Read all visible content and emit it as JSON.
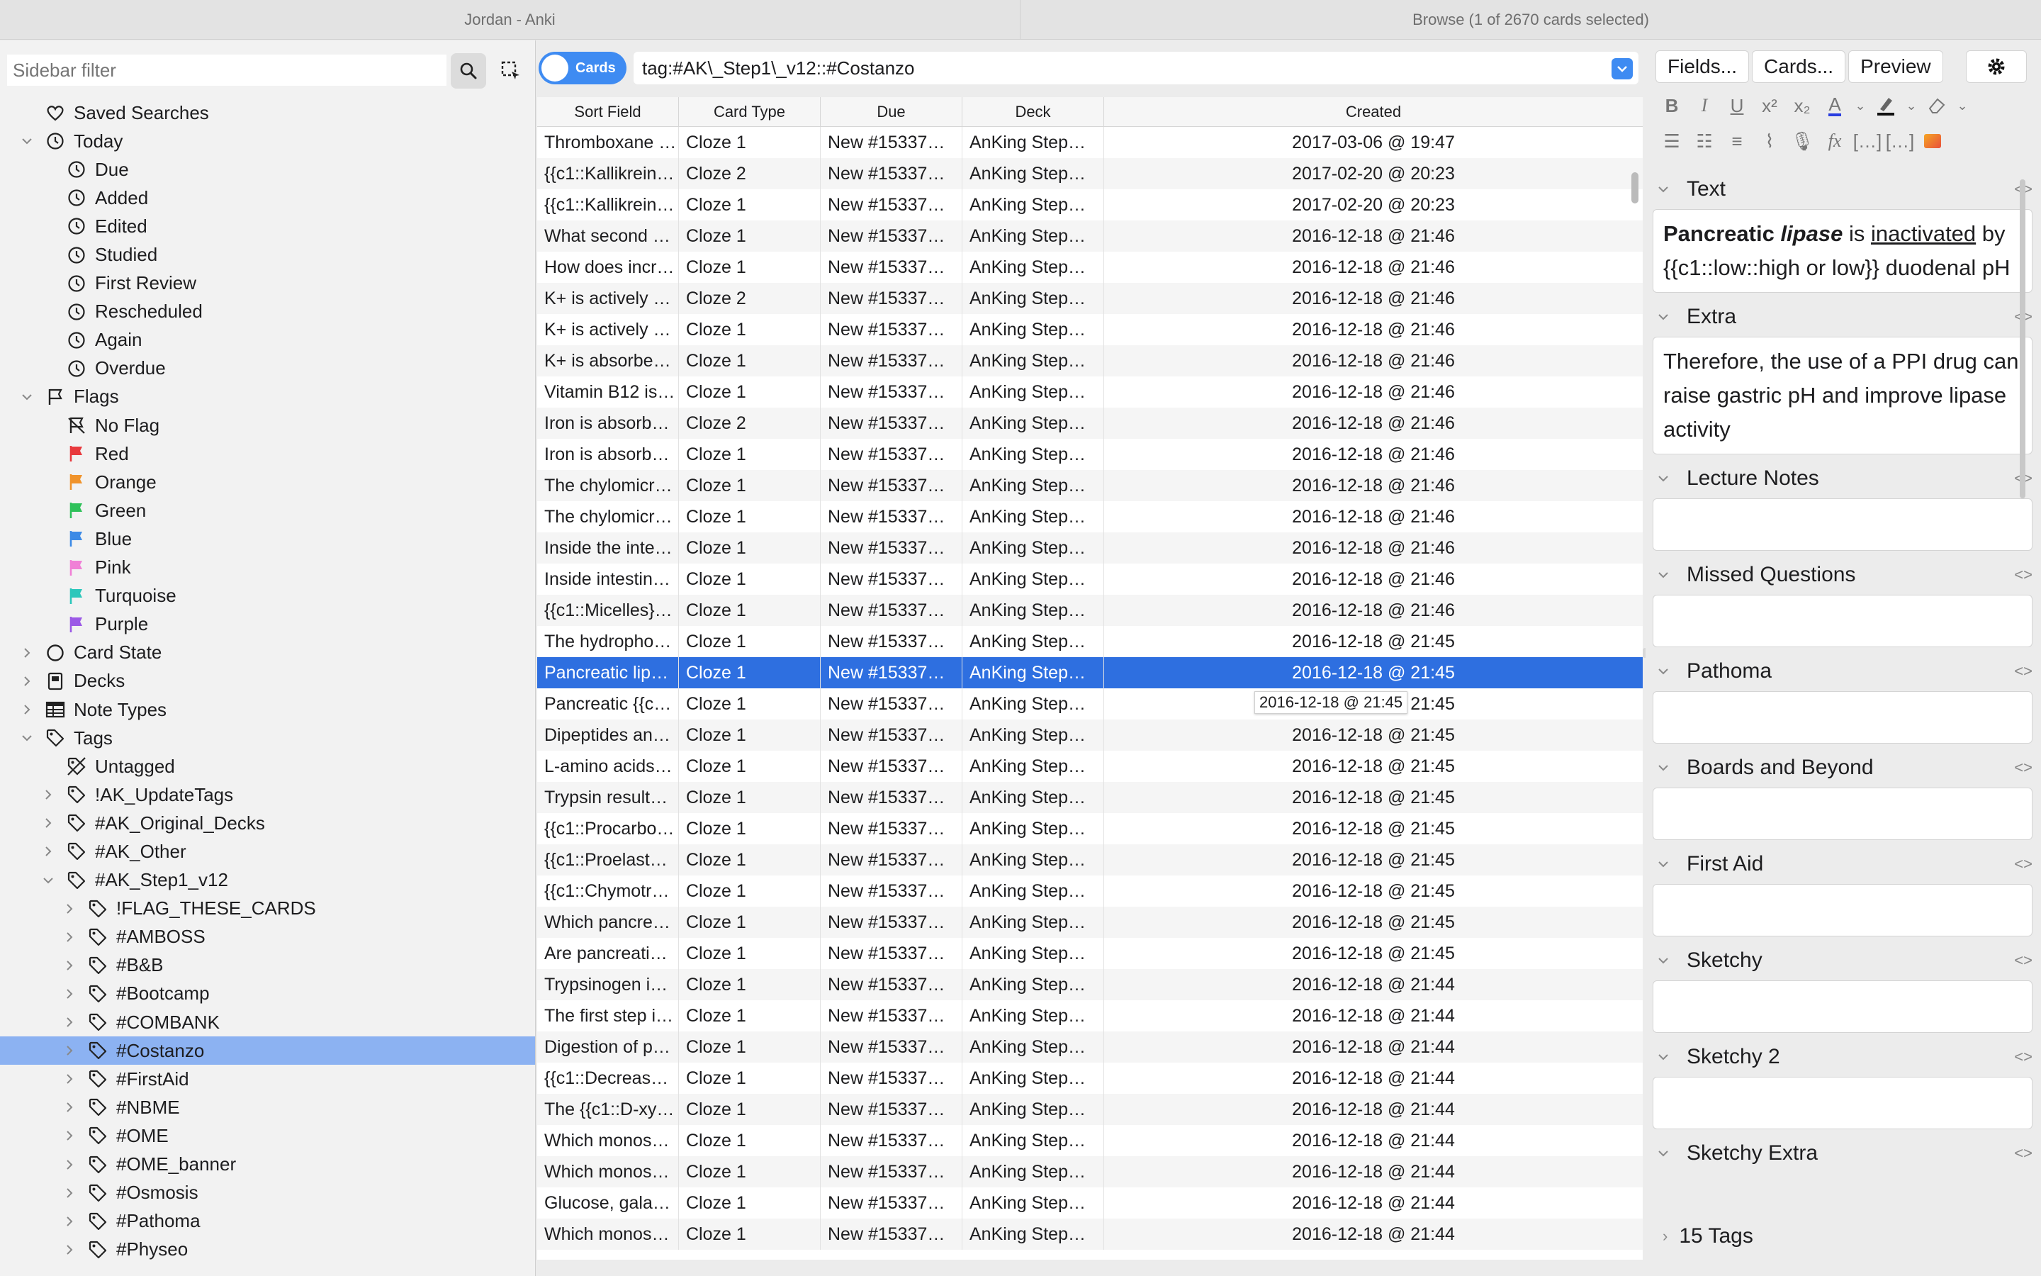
{
  "window": {
    "left_title": "Jordan - Anki",
    "right_title": "Browse (1 of 2670 cards selected)"
  },
  "sidebar": {
    "filter_placeholder": "Sidebar filter",
    "items": [
      {
        "label": "Saved Searches",
        "level": 0,
        "icon": "heart-icon",
        "chevron": ""
      },
      {
        "label": "Today",
        "level": 0,
        "icon": "clock-icon",
        "chevron": "open"
      },
      {
        "label": "Due",
        "level": 1,
        "icon": "clock-icon",
        "chevron": ""
      },
      {
        "label": "Added",
        "level": 1,
        "icon": "clock-icon",
        "chevron": ""
      },
      {
        "label": "Edited",
        "level": 1,
        "icon": "clock-icon",
        "chevron": ""
      },
      {
        "label": "Studied",
        "level": 1,
        "icon": "clock-icon",
        "chevron": ""
      },
      {
        "label": "First Review",
        "level": 1,
        "icon": "clock-icon",
        "chevron": ""
      },
      {
        "label": "Rescheduled",
        "level": 1,
        "icon": "clock-icon",
        "chevron": ""
      },
      {
        "label": "Again",
        "level": 1,
        "icon": "clock-icon",
        "chevron": ""
      },
      {
        "label": "Overdue",
        "level": 1,
        "icon": "clock-icon",
        "chevron": ""
      },
      {
        "label": "Flags",
        "level": 0,
        "icon": "flag-outline-icon",
        "chevron": "open"
      },
      {
        "label": "No Flag",
        "level": 1,
        "icon": "no-flag-icon",
        "chevron": ""
      },
      {
        "label": "Red",
        "level": 1,
        "icon": "flag-icon",
        "color": "#e8393d",
        "chevron": ""
      },
      {
        "label": "Orange",
        "level": 1,
        "icon": "flag-icon",
        "color": "#f0932b",
        "chevron": ""
      },
      {
        "label": "Green",
        "level": 1,
        "icon": "flag-icon",
        "color": "#2fc15a",
        "chevron": ""
      },
      {
        "label": "Blue",
        "level": 1,
        "icon": "flag-icon",
        "color": "#3c8ae6",
        "chevron": ""
      },
      {
        "label": "Pink",
        "level": 1,
        "icon": "flag-icon",
        "color": "#f080d6",
        "chevron": ""
      },
      {
        "label": "Turquoise",
        "level": 1,
        "icon": "flag-icon",
        "color": "#2cc7bb",
        "chevron": ""
      },
      {
        "label": "Purple",
        "level": 1,
        "icon": "flag-icon",
        "color": "#9b59e6",
        "chevron": ""
      },
      {
        "label": "Card State",
        "level": 0,
        "icon": "circle-icon",
        "chevron": "closed"
      },
      {
        "label": "Decks",
        "level": 0,
        "icon": "deck-icon",
        "chevron": "closed"
      },
      {
        "label": "Note Types",
        "level": 0,
        "icon": "table-icon",
        "chevron": "closed"
      },
      {
        "label": "Tags",
        "level": 0,
        "icon": "tag-icon",
        "chevron": "open"
      },
      {
        "label": "Untagged",
        "level": 1,
        "icon": "untagged-icon",
        "chevron": ""
      },
      {
        "label": "!AK_UpdateTags",
        "level": 1,
        "icon": "tag-icon",
        "chevron": "closed"
      },
      {
        "label": "#AK_Original_Decks",
        "level": 1,
        "icon": "tag-icon",
        "chevron": "closed"
      },
      {
        "label": "#AK_Other",
        "level": 1,
        "icon": "tag-icon",
        "chevron": "closed"
      },
      {
        "label": "#AK_Step1_v12",
        "level": 1,
        "icon": "tag-icon",
        "chevron": "open"
      },
      {
        "label": "!FLAG_THESE_CARDS",
        "level": 2,
        "icon": "tag-icon",
        "chevron": "closed"
      },
      {
        "label": "#AMBOSS",
        "level": 2,
        "icon": "tag-icon",
        "chevron": "closed"
      },
      {
        "label": "#B&B",
        "level": 2,
        "icon": "tag-icon",
        "chevron": "closed"
      },
      {
        "label": "#Bootcamp",
        "level": 2,
        "icon": "tag-icon",
        "chevron": "closed"
      },
      {
        "label": "#COMBANK",
        "level": 2,
        "icon": "tag-icon",
        "chevron": "closed"
      },
      {
        "label": "#Costanzo",
        "level": 2,
        "icon": "tag-icon",
        "chevron": "closed",
        "selected": true
      },
      {
        "label": "#FirstAid",
        "level": 2,
        "icon": "tag-icon",
        "chevron": "closed"
      },
      {
        "label": "#NBME",
        "level": 2,
        "icon": "tag-icon",
        "chevron": "closed"
      },
      {
        "label": "#OME",
        "level": 2,
        "icon": "tag-icon",
        "chevron": "closed"
      },
      {
        "label": "#OME_banner",
        "level": 2,
        "icon": "tag-icon",
        "chevron": "closed"
      },
      {
        "label": "#Osmosis",
        "level": 2,
        "icon": "tag-icon",
        "chevron": "closed"
      },
      {
        "label": "#Pathoma",
        "level": 2,
        "icon": "tag-icon",
        "chevron": "closed"
      },
      {
        "label": "#Physeo",
        "level": 2,
        "icon": "tag-icon",
        "chevron": "closed"
      }
    ]
  },
  "toolbar": {
    "mode_label": "Cards",
    "search_text": "tag:#AK\\_Step1\\_v12::#Costanzo"
  },
  "grid": {
    "columns": [
      "Sort Field",
      "Card Type",
      "Due",
      "Deck",
      "Created"
    ],
    "rows": [
      [
        "Thromboxane …",
        "Cloze 1",
        "New #15337…",
        "AnKing Step…",
        "2017-03-06 @ 19:47"
      ],
      [
        "{{c1::Kallikrein…",
        "Cloze 2",
        "New #15337…",
        "AnKing Step…",
        "2017-02-20 @ 20:23"
      ],
      [
        "{{c1::Kallikrein…",
        "Cloze 1",
        "New #15337…",
        "AnKing Step…",
        "2017-02-20 @ 20:23"
      ],
      [
        "What second …",
        "Cloze 1",
        "New #15337…",
        "AnKing Step…",
        "2016-12-18 @ 21:46"
      ],
      [
        "How does incr…",
        "Cloze 1",
        "New #15337…",
        "AnKing Step…",
        "2016-12-18 @ 21:46"
      ],
      [
        "K+ is actively …",
        "Cloze 2",
        "New #15337…",
        "AnKing Step…",
        "2016-12-18 @ 21:46"
      ],
      [
        "K+ is actively …",
        "Cloze 1",
        "New #15337…",
        "AnKing Step…",
        "2016-12-18 @ 21:46"
      ],
      [
        "K+ is absorbe…",
        "Cloze 1",
        "New #15337…",
        "AnKing Step…",
        "2016-12-18 @ 21:46"
      ],
      [
        "Vitamin B12 is…",
        "Cloze 1",
        "New #15337…",
        "AnKing Step…",
        "2016-12-18 @ 21:46"
      ],
      [
        "Iron is absorb…",
        "Cloze 2",
        "New #15337…",
        "AnKing Step…",
        "2016-12-18 @ 21:46"
      ],
      [
        "Iron is absorb…",
        "Cloze 1",
        "New #15337…",
        "AnKing Step…",
        "2016-12-18 @ 21:46"
      ],
      [
        "The chylomicr…",
        "Cloze 1",
        "New #15337…",
        "AnKing Step…",
        "2016-12-18 @ 21:46"
      ],
      [
        "The chylomicr…",
        "Cloze 1",
        "New #15337…",
        "AnKing Step…",
        "2016-12-18 @ 21:46"
      ],
      [
        "Inside the inte…",
        "Cloze 1",
        "New #15337…",
        "AnKing Step…",
        "2016-12-18 @ 21:46"
      ],
      [
        "Inside intestin…",
        "Cloze 1",
        "New #15337…",
        "AnKing Step…",
        "2016-12-18 @ 21:46"
      ],
      [
        "{{c1::Micelles}…",
        "Cloze 1",
        "New #15337…",
        "AnKing Step…",
        "2016-12-18 @ 21:46"
      ],
      [
        "The hydropho…",
        "Cloze 1",
        "New #15337…",
        "AnKing Step…",
        "2016-12-18 @ 21:45"
      ],
      [
        "Pancreatic lip…",
        "Cloze 1",
        "New #15337…",
        "AnKing Step…",
        "2016-12-18 @ 21:45"
      ],
      [
        "Pancreatic {{c…",
        "Cloze 1",
        "New #15337…",
        "AnKing Step…",
        "2016-12-18 @ 21:45"
      ],
      [
        "Dipeptides an…",
        "Cloze 1",
        "New #15337…",
        "AnKing Step…",
        "2016-12-18 @ 21:45"
      ],
      [
        "L-amino acids…",
        "Cloze 1",
        "New #15337…",
        "AnKing Step…",
        "2016-12-18 @ 21:45"
      ],
      [
        "Trypsin result…",
        "Cloze 1",
        "New #15337…",
        "AnKing Step…",
        "2016-12-18 @ 21:45"
      ],
      [
        "{{c1::Procarbo…",
        "Cloze 1",
        "New #15337…",
        "AnKing Step…",
        "2016-12-18 @ 21:45"
      ],
      [
        "{{c1::Proelast…",
        "Cloze 1",
        "New #15337…",
        "AnKing Step…",
        "2016-12-18 @ 21:45"
      ],
      [
        "{{c1::Chymotr…",
        "Cloze 1",
        "New #15337…",
        "AnKing Step…",
        "2016-12-18 @ 21:45"
      ],
      [
        "Which pancre…",
        "Cloze 1",
        "New #15337…",
        "AnKing Step…",
        "2016-12-18 @ 21:45"
      ],
      [
        "Are pancreati…",
        "Cloze 1",
        "New #15337…",
        "AnKing Step…",
        "2016-12-18 @ 21:45"
      ],
      [
        "Trypsinogen i…",
        "Cloze 1",
        "New #15337…",
        "AnKing Step…",
        "2016-12-18 @ 21:44"
      ],
      [
        "The first step i…",
        "Cloze 1",
        "New #15337…",
        "AnKing Step…",
        "2016-12-18 @ 21:44"
      ],
      [
        "Digestion of p…",
        "Cloze 1",
        "New #15337…",
        "AnKing Step…",
        "2016-12-18 @ 21:44"
      ],
      [
        "{{c1::Decreas…",
        "Cloze 1",
        "New #15337…",
        "AnKing Step…",
        "2016-12-18 @ 21:44"
      ],
      [
        "The {{c1::D-xy…",
        "Cloze 1",
        "New #15337…",
        "AnKing Step…",
        "2016-12-18 @ 21:44"
      ],
      [
        "Which monos…",
        "Cloze 1",
        "New #15337…",
        "AnKing Step…",
        "2016-12-18 @ 21:44"
      ],
      [
        "Which monos…",
        "Cloze 1",
        "New #15337…",
        "AnKing Step…",
        "2016-12-18 @ 21:44"
      ],
      [
        "Glucose, gala…",
        "Cloze 1",
        "New #15337…",
        "AnKing Step…",
        "2016-12-18 @ 21:44"
      ],
      [
        "Which monos…",
        "Cloze 1",
        "New #15337…",
        "AnKing Step…",
        "2016-12-18 @ 21:44"
      ]
    ],
    "selected_index": 17,
    "tooltip": "2016-12-18 @ 21:45"
  },
  "editor": {
    "tabs": [
      "Fields...",
      "Cards...",
      "Preview"
    ],
    "fields": [
      {
        "name": "Text",
        "content_html": "<b>Pancreatic <i>lipase</i></b> is <u>inactivated</u> by {{c1::low::high or low}} duodenal pH"
      },
      {
        "name": "Extra",
        "content_html": "Therefore, the use of a PPI drug can raise gastric pH and improve lipase activity"
      },
      {
        "name": "Lecture Notes",
        "content_html": ""
      },
      {
        "name": "Missed Questions",
        "content_html": ""
      },
      {
        "name": "Pathoma",
        "content_html": ""
      },
      {
        "name": "Boards and Beyond",
        "content_html": ""
      },
      {
        "name": "First Aid",
        "content_html": ""
      },
      {
        "name": "Sketchy",
        "content_html": ""
      },
      {
        "name": "Sketchy 2",
        "content_html": ""
      },
      {
        "name": "Sketchy Extra",
        "content_html": ""
      }
    ],
    "tags_label": "15 Tags",
    "html_toggle": "<>"
  },
  "colors": {
    "accent": "#3e8bf2",
    "selected_row": "#2e6fe0",
    "sidebar_selected": "#8cb2f2"
  }
}
